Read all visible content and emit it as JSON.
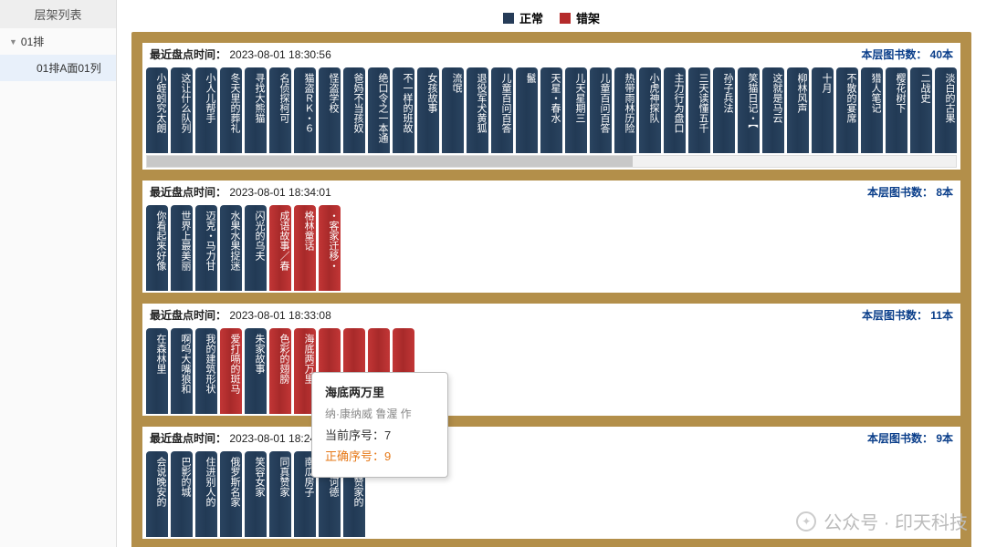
{
  "sidebar": {
    "header": "层架列表",
    "root": "01排",
    "child": "01排A面01列"
  },
  "legend": {
    "normal": "正常",
    "error": "错架"
  },
  "labels": {
    "last_check": "最近盘点时间：",
    "book_count_prefix": "本层图书数：",
    "book_count_suffix": "本"
  },
  "tooltip": {
    "title": "海底两万里",
    "subtitle": "纳·康纳威 鲁渥 作",
    "current_label": "当前序号：",
    "current": "7",
    "correct_label": "正确序号：",
    "correct": "9"
  },
  "watermark": "公众号 · 印天科技",
  "levels": [
    {
      "ts": "2023-08-01 18:30:56",
      "count": "40",
      "scrollbar": true,
      "books": [
        {
          "t": "小蛭蚓究太朗",
          "e": false
        },
        {
          "t": "这让什么队列",
          "e": false
        },
        {
          "t": "小人儿帮手",
          "e": false
        },
        {
          "t": "冬天里的葬礼",
          "e": false
        },
        {
          "t": "寻找大熊猫",
          "e": false
        },
        {
          "t": "名侦探柯可",
          "e": false
        },
        {
          "t": "猫盗ＲＫ・６",
          "e": false
        },
        {
          "t": "怪盗学校",
          "e": false
        },
        {
          "t": "爸妈不当孩奴",
          "e": false
        },
        {
          "t": "绝口令之一本通",
          "e": false
        },
        {
          "t": "不一样的班故",
          "e": false
        },
        {
          "t": "女孩故事",
          "e": false
        },
        {
          "t": "流氓",
          "e": false
        },
        {
          "t": "退役军犬黄狐",
          "e": false
        },
        {
          "t": "儿童百问百答",
          "e": false
        },
        {
          "t": "鬣",
          "e": false
        },
        {
          "t": "天星・春水",
          "e": false
        },
        {
          "t": "儿天星期三",
          "e": false
        },
        {
          "t": "儿童百问百答",
          "e": false
        },
        {
          "t": "热带雨林历险",
          "e": false
        },
        {
          "t": "小虎神探队",
          "e": false
        },
        {
          "t": "主力行为盘口",
          "e": false
        },
        {
          "t": "三天读懂五千",
          "e": false
        },
        {
          "t": "孙子兵法",
          "e": false
        },
        {
          "t": "笑猫日记・【",
          "e": false
        },
        {
          "t": "这就是马云",
          "e": false
        },
        {
          "t": "柳林风声",
          "e": false
        },
        {
          "t": "十月",
          "e": false
        },
        {
          "t": "不散的宴席",
          "e": false
        },
        {
          "t": "猎人笔记",
          "e": false
        },
        {
          "t": "樱花树下",
          "e": false
        },
        {
          "t": "二战史",
          "e": false
        },
        {
          "t": "淡白的古果",
          "e": false
        }
      ]
    },
    {
      "ts": "2023-08-01 18:34:01",
      "count": "8",
      "scrollbar": false,
      "books": [
        {
          "t": "你看起来好像",
          "e": false
        },
        {
          "t": "世界上最美丽",
          "e": false
        },
        {
          "t": "迈克・马力甘",
          "e": false
        },
        {
          "t": "水果水果捉迷",
          "e": false
        },
        {
          "t": "闪光的乌夫",
          "e": false
        },
        {
          "t": "成语故事／春",
          "e": true
        },
        {
          "t": "格林童话",
          "e": true
        },
        {
          "t": "・客家迁移・",
          "e": true
        }
      ]
    },
    {
      "ts": "2023-08-01 18:33:08",
      "count": "11",
      "scrollbar": false,
      "books": [
        {
          "t": "在森林里",
          "e": false
        },
        {
          "t": "啊呜大嘴狼和",
          "e": false
        },
        {
          "t": "我的建筑形状",
          "e": false
        },
        {
          "t": "爱打嗝的斑马",
          "e": true
        },
        {
          "t": "朱家故事",
          "e": false
        },
        {
          "t": "色彩的翅膀",
          "e": true
        },
        {
          "t": "海底两万里",
          "e": true
        },
        {
          "t": "",
          "e": true
        },
        {
          "t": "",
          "e": true
        },
        {
          "t": "",
          "e": true
        },
        {
          "t": "",
          "e": true
        }
      ]
    },
    {
      "ts": "2023-08-01 18:24:44",
      "count": "9",
      "scrollbar": false,
      "books": [
        {
          "t": "会说晚安的",
          "e": false
        },
        {
          "t": "巴影的城",
          "e": false
        },
        {
          "t": "住进别人的",
          "e": false
        },
        {
          "t": "俄罗斯名家",
          "e": false
        },
        {
          "t": "笑容女家",
          "e": false
        },
        {
          "t": "同真赞家",
          "e": false
        },
        {
          "t": "南瓜房子",
          "e": false
        },
        {
          "t": "堂吉诃德",
          "e": false
        },
        {
          "t": "同真赞家的",
          "e": false
        }
      ]
    }
  ]
}
